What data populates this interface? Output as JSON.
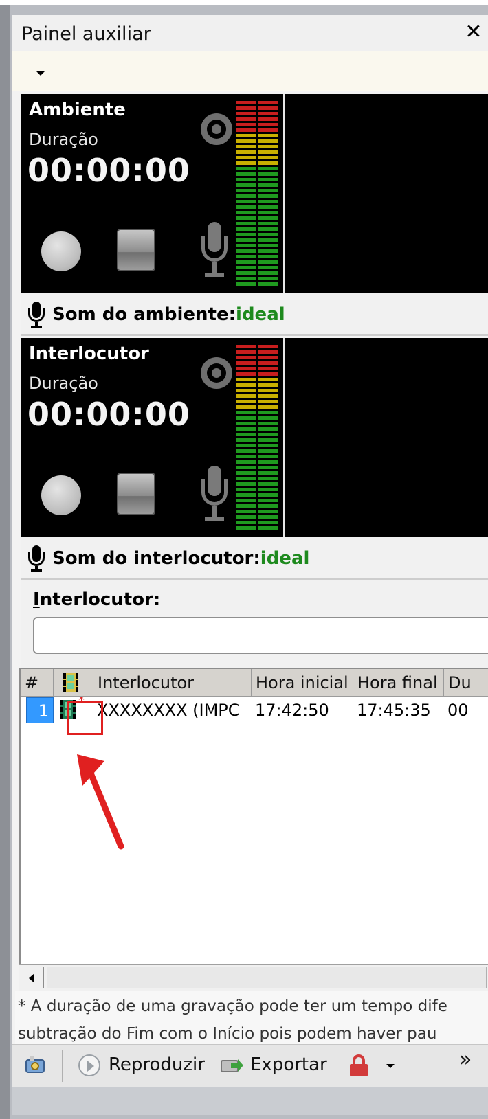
{
  "panel": {
    "title": "Painel auxiliar",
    "close_glyph": "✕"
  },
  "recorders": [
    {
      "name": "Ambiente",
      "duration_label": "Duração",
      "timer": "00:00:00",
      "sound_label": "Som do ambiente:",
      "sound_value": "ideal"
    },
    {
      "name": "Interlocutor",
      "duration_label": "Duração",
      "timer": "00:00:00",
      "sound_label": "Som do interlocutor:",
      "sound_value": "ideal"
    }
  ],
  "interlocutor_field": {
    "label_underlined": "I",
    "label_rest": "nterlocutor:",
    "value": ""
  },
  "grid": {
    "columns": [
      "#",
      "",
      "Interlocutor",
      "Hora inicial",
      "Hora final",
      "Du"
    ],
    "rows": [
      {
        "num": "1",
        "interlocutor": "XXXXXXXX (IMPC",
        "hora_inicial": "17:42:50",
        "hora_final": "17:45:35",
        "duracao": "00"
      }
    ]
  },
  "footnote": {
    "line1": "* A duração de uma gravação pode ter um tempo dife",
    "line2": "subtração do Fim com o Início pois podem haver pau"
  },
  "toolbar": {
    "play_label": "Reproduzir",
    "export_label": "Exportar",
    "overflow_glyph": "»"
  },
  "icons": {
    "target": "target-icon",
    "record": "record-button-icon",
    "stop": "stop-button-icon",
    "mic": "microphone-icon",
    "film": "film-icon",
    "lock": "lock-icon",
    "play": "play-circle-icon",
    "export": "export-icon",
    "settings": "toolbar-settings-icon"
  },
  "colors": {
    "ideal_green": "#1e8a1e",
    "selection_blue": "#3399ff",
    "callout_red": "#e02020",
    "vu_red": "#c81e1e",
    "vu_yellow": "#c9b000",
    "vu_green": "#1f9a1f"
  }
}
